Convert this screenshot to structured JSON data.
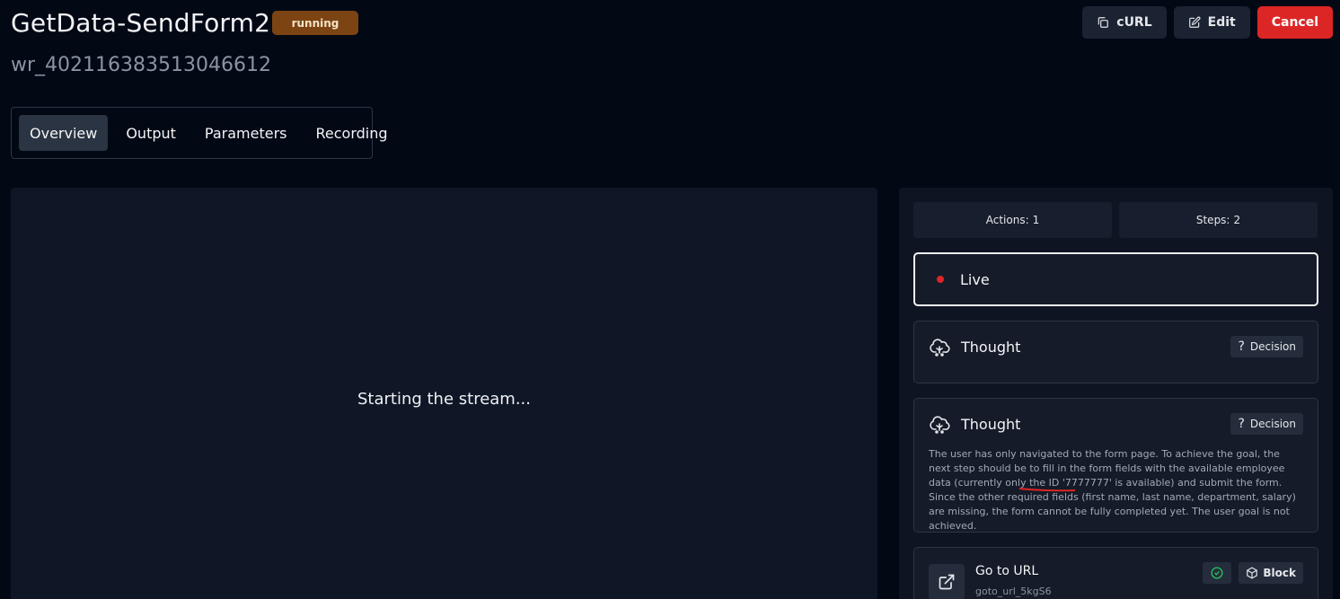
{
  "header": {
    "title": "GetData-SendForm2",
    "status": "running",
    "run_id": "wr_402116383513046612",
    "actions": {
      "curl_label": "cURL",
      "edit_label": "Edit",
      "cancel_label": "Cancel"
    }
  },
  "tabs": [
    {
      "label": "Overview",
      "active": true
    },
    {
      "label": "Output",
      "active": false
    },
    {
      "label": "Parameters",
      "active": false
    },
    {
      "label": "Recording",
      "active": false
    }
  ],
  "stream": {
    "message": "Starting the stream..."
  },
  "sidebar": {
    "actions_label": "Actions:",
    "actions_count": "1",
    "steps_label": "Steps:",
    "steps_count": "2",
    "live_label": "Live",
    "thought1": {
      "title": "Thought",
      "tag": "Decision"
    },
    "thought2": {
      "title": "Thought",
      "tag": "Decision",
      "body": "The user has only navigated to the form page. To achieve the goal, the next step should be to fill in the form fields with the available employee data (currently only the ID '7777777' is available) and submit the form. Since the other required fields (first name, last name, department, salary) are missing, the form cannot be fully completed yet. The user goal is not achieved."
    },
    "goto": {
      "title": "Go to URL",
      "subtitle": "goto_url_5kgS6",
      "tag": "Block"
    }
  },
  "colors": {
    "background": "#030815",
    "panel": "#0f1625",
    "status_running": "#7c4413",
    "cancel": "#dc2626",
    "live_dot": "#dc2626",
    "success": "#22c55e"
  }
}
